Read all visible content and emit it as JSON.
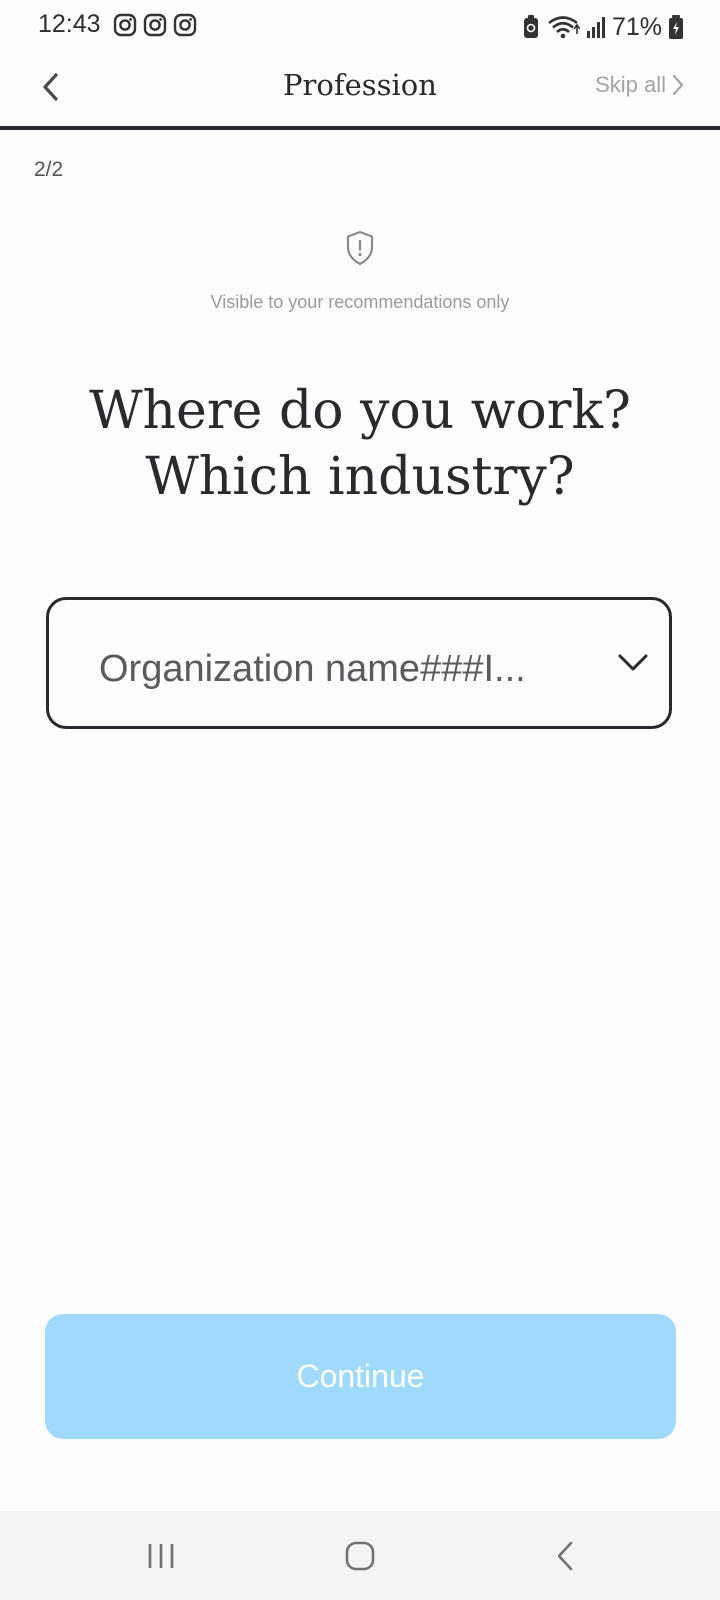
{
  "status_bar": {
    "time": "12:43",
    "battery_percent": "71%",
    "icons": [
      "instagram-icon",
      "instagram-icon",
      "instagram-icon",
      "battery-saver-icon",
      "wifi-icon",
      "signal-icon",
      "battery-icon"
    ]
  },
  "app_bar": {
    "title": "Profession",
    "skip_label": "Skip all",
    "back_icon": "chevron-left-icon",
    "skip_icon": "chevron-right-icon"
  },
  "progress": {
    "step": "2/2",
    "fraction": 1.0
  },
  "visibility": {
    "icon": "shield-icon",
    "text": "Visible to your recommendations only"
  },
  "question": {
    "line1": "Where do you work?",
    "line2": "Which industry?"
  },
  "org_select": {
    "value": "Organization name###I...",
    "icon": "chevron-down-icon"
  },
  "continue_button": {
    "label": "Continue"
  },
  "colors": {
    "accent_disabled": "#9fd9fb",
    "text_primary": "#2a2a2e",
    "text_muted": "#a4a4a8"
  },
  "nav_bar": {
    "icons": [
      "recent-apps-icon",
      "home-icon",
      "back-icon"
    ]
  }
}
